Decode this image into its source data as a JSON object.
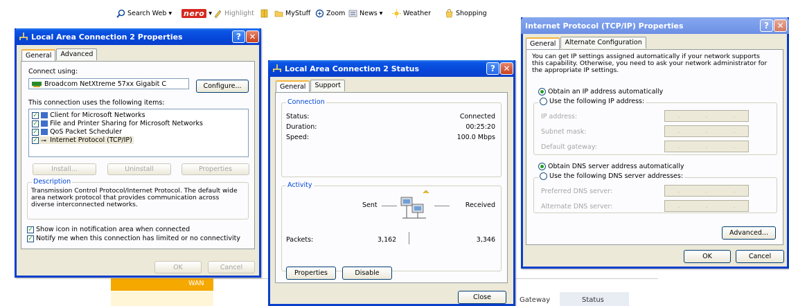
{
  "toolbar": {
    "search_web": "Search Web",
    "nero": "nero",
    "highlight": "Highlight",
    "mystuff": "MyStuff",
    "zoom": "Zoom",
    "news": "News",
    "weather": "Weather",
    "shopping": "Shopping"
  },
  "background": {
    "wan": "WAN",
    "gateway": "Gateway",
    "status": "Status"
  },
  "lac_props": {
    "title": "Local Area Connection 2 Properties",
    "tabs": [
      "General",
      "Advanced"
    ],
    "connect_using": "Connect using:",
    "adapter": "Broadcom NetXtreme 57xx Gigabit C",
    "configure": "Configure...",
    "items_label": "This connection uses the following items:",
    "items": [
      "Client for Microsoft Networks",
      "File and Printer Sharing for Microsoft Networks",
      "QoS Packet Scheduler",
      "Internet Protocol (TCP/IP)"
    ],
    "install": "Install...",
    "uninstall": "Uninstall",
    "properties": "Properties",
    "description_title": "Description",
    "description": "Transmission Control Protocol/Internet Protocol. The default wide area network protocol that provides communication across diverse interconnected networks.",
    "show_icon": "Show icon in notification area when connected",
    "notify": "Notify me when this connection has limited or no connectivity",
    "ok": "OK",
    "cancel": "Cancel"
  },
  "lac_status": {
    "title": "Local Area Connection 2 Status",
    "tabs": [
      "General",
      "Support"
    ],
    "connection_title": "Connection",
    "status_label": "Status:",
    "status_value": "Connected",
    "duration_label": "Duration:",
    "duration_value": "00:25:20",
    "speed_label": "Speed:",
    "speed_value": "100.0 Mbps",
    "activity_title": "Activity",
    "sent": "Sent",
    "received": "Received",
    "packets_label": "Packets:",
    "packets_sent": "3,162",
    "packets_received": "3,346",
    "properties": "Properties",
    "disable": "Disable",
    "close": "Close"
  },
  "tcpip": {
    "title": "Internet Protocol (TCP/IP) Properties",
    "tabs": [
      "General",
      "Alternate Configuration"
    ],
    "intro": "You can get IP settings assigned automatically if your network supports this capability. Otherwise, you need to ask your network administrator for the appropriate IP settings.",
    "obtain_ip": "Obtain an IP address automatically",
    "use_ip": "Use the following IP address:",
    "ip_address": "IP address:",
    "subnet_mask": "Subnet mask:",
    "default_gateway": "Default gateway:",
    "obtain_dns": "Obtain DNS server address automatically",
    "use_dns": "Use the following DNS server addresses:",
    "preferred_dns": "Preferred DNS server:",
    "alternate_dns": "Alternate DNS server:",
    "advanced": "Advanced...",
    "ok": "OK",
    "cancel": "Cancel"
  },
  "colors": {
    "titlebar": "#0a3fcb",
    "dialog_bg": "#ece9d8",
    "wan_bar": "#f5a800"
  }
}
